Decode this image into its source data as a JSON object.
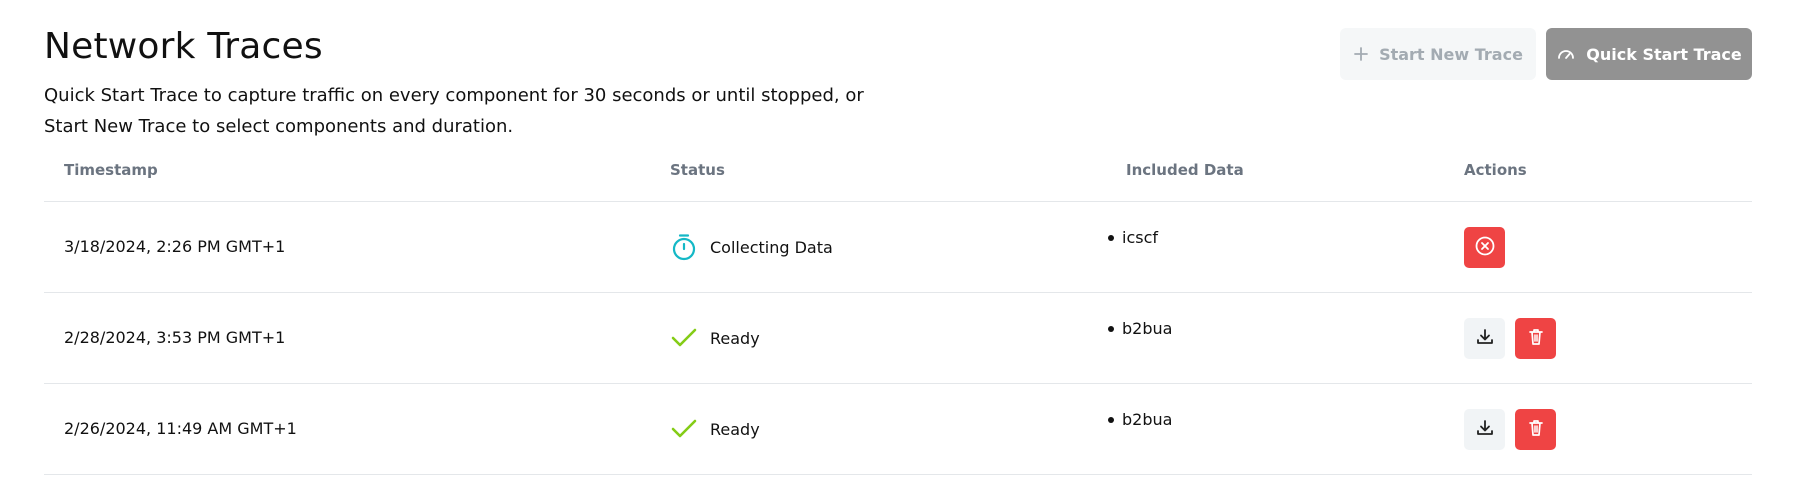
{
  "header": {
    "title": "Network Traces",
    "description": "Quick Start Trace to capture traffic on every component for 30 seconds or until stopped, or Start New Trace to select components and duration."
  },
  "toolbar": {
    "start_new_label": "Start New Trace",
    "quick_start_label": "Quick Start Trace"
  },
  "table": {
    "columns": [
      "Timestamp",
      "Status",
      "Included Data",
      "Actions"
    ],
    "rows": [
      {
        "timestamp": "3/18/2024, 2:26 PM GMT+1",
        "status": "Collecting Data",
        "status_icon": "stopwatch-icon",
        "data": "icscf",
        "actions": [
          "stop"
        ]
      },
      {
        "timestamp": "2/28/2024, 3:53 PM GMT+1",
        "status": "Ready",
        "status_icon": "check-icon",
        "data": "b2bua",
        "actions": [
          "download",
          "delete"
        ]
      },
      {
        "timestamp": "2/26/2024, 11:49 AM GMT+1",
        "status": "Ready",
        "status_icon": "check-icon",
        "data": "b2bua",
        "actions": [
          "download",
          "delete"
        ]
      }
    ]
  },
  "colors": {
    "danger": "#ef4444",
    "ready": "#84cc16",
    "collecting": "#14b8c6",
    "muted_button": "#929292"
  }
}
